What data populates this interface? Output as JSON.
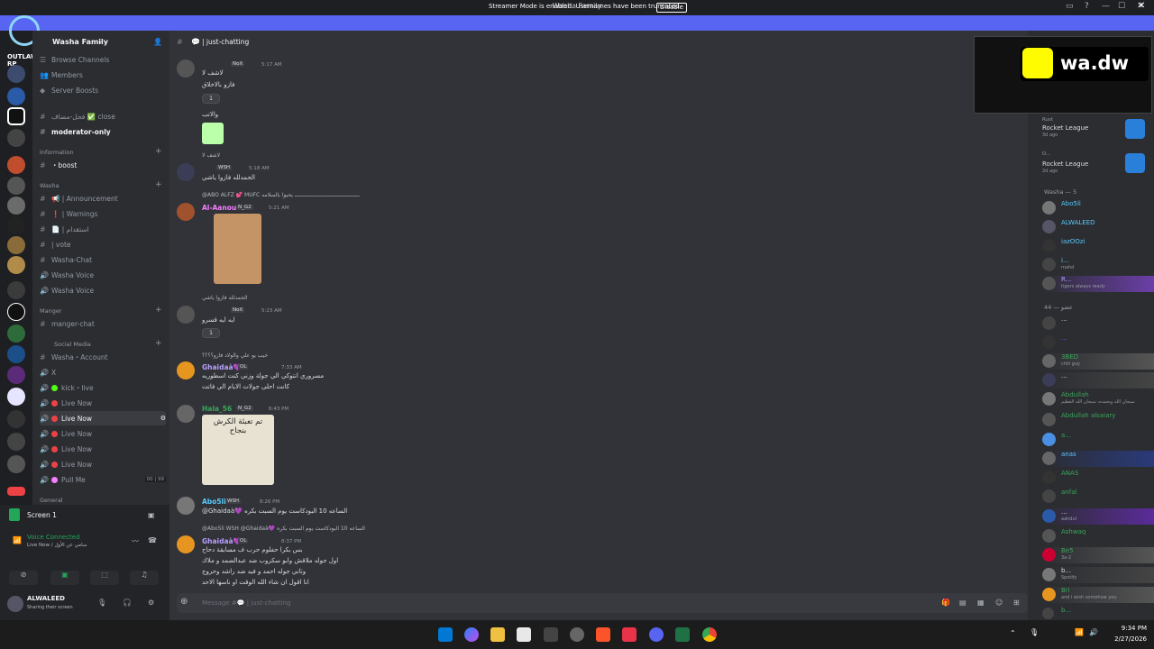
{
  "window": {
    "title": "Washa Family",
    "controls": [
      "—",
      "☐",
      "✕"
    ]
  },
  "banner": {
    "text": "Streamer Mode is enabled. Usernames have been truncated.",
    "button": "Disable",
    "color": "#5865f2"
  },
  "guild_logo": {
    "text": "OUTLAW RP"
  },
  "server": {
    "name": "Washa Family"
  },
  "sidebar": {
    "top_items": [
      {
        "label": "Browse Channels",
        "icon": "browse-icon"
      },
      {
        "label": "Members",
        "icon": "members-icon"
      },
      {
        "label": "Server Boosts",
        "icon": "boost-icon"
      }
    ],
    "channels": [
      {
        "label": "فحل-مضاف ✅ close",
        "type": "text"
      },
      {
        "label": "moderator-only",
        "type": "text",
        "active": true
      },
      {
        "label": "Information",
        "type": "category"
      },
      {
        "label": "・boost",
        "type": "text",
        "active": true
      },
      {
        "label": "Washa",
        "type": "category"
      },
      {
        "label": "📢 | Announcement",
        "type": "text"
      },
      {
        "label": "❗ | Warnings",
        "type": "text"
      },
      {
        "label": "📄 | استقدام",
        "type": "text"
      },
      {
        "label": "| vote",
        "type": "text"
      },
      {
        "label": "Washa-Chat",
        "type": "text"
      },
      {
        "label": "Washa Voice",
        "type": "voice"
      },
      {
        "label": "Washa Voice",
        "type": "voice"
      },
      {
        "label": "Manger",
        "type": "category"
      },
      {
        "label": "manger-chat",
        "type": "text"
      },
      {
        "label": "Social Media",
        "type": "category"
      },
      {
        "label": "Washa・Account",
        "type": "text"
      },
      {
        "label": "X",
        "type": "voice"
      },
      {
        "label": "kick・live",
        "type": "voice"
      },
      {
        "label": "Live Now",
        "type": "voice"
      },
      {
        "label": "Live Now",
        "type": "voice",
        "active": true
      },
      {
        "label": "Live Now",
        "type": "voice"
      },
      {
        "label": "Live Now",
        "type": "voice"
      },
      {
        "label": "Live Now",
        "type": "voice"
      },
      {
        "label": "Pull Me",
        "type": "voice",
        "counts": "00 | 99"
      },
      {
        "label": "General",
        "type": "category"
      }
    ]
  },
  "stream_panel": {
    "label": "Screen 1"
  },
  "voice": {
    "status": "Voice Connected",
    "channel": "Live Now / سامي عن الأول"
  },
  "user": {
    "name": "ALWALEED",
    "status": "Sharing their screen"
  },
  "channel_header": {
    "name": "| just-chatting"
  },
  "messages": [
    {
      "name": "",
      "tag": "NoX",
      "time": "5:17 AM",
      "lines": [
        "لاشف لا",
        "فازو بالاخلاق"
      ],
      "reaction": "1",
      "extra": "والاتب"
    },
    {
      "name": "",
      "reply": "لاشف لا",
      "tag": "WSH",
      "time": "5:18 AM",
      "lines": [
        "الحمدلله فازوا ياشي"
      ]
    },
    {
      "name": "Al-Aanoud",
      "reply": "@ABO ALFZ 💕 MUFC ـــــــــــــــــــــــــــــــــــــــــ يحيوا بالسلامه",
      "tag": "N_G2",
      "time": "5:21 AM"
    },
    {
      "name": "",
      "reply": "الحمدلله فازوا ياشي",
      "tag": "NoX",
      "time": "5:23 AM",
      "lines": [
        "ايه ايه قسرو"
      ],
      "reaction": "1"
    },
    {
      "name": "Ghaidaà💜",
      "reply": "خيب يو علي والولاد فازو؟؟؟؟",
      "tag": "OL",
      "time": "7:33 AM",
      "lines": [
        "مسروري انتوكي الي جولة وزني كنت اسطوريه",
        "كانت احلى جولات الايام الي فاتت"
      ]
    },
    {
      "name": "Hala_56",
      "tag": "N_G2",
      "time": "6:43 PM",
      "sticker": "تم تعبئة الكرش بنجاح"
    },
    {
      "name": "Abo5li",
      "tag": "WSH",
      "time": "8:26 PM",
      "lines": [
        "@Ghaidaà💜 الساعه 10 البودكاست يوم السبت بكره"
      ]
    },
    {
      "name": "Ghaidaà💜",
      "reply": "@Abo5li WSH @Ghaidaà💜 الساعه 10 البودكاست يوم السبت بكره",
      "tag": "OL",
      "time": "8:37 PM",
      "lines": [
        "بس بكرا حفلوم حرب ف مسابقة دحاح",
        "اول جوله ملاقش وابو سكروب ضد عبدالصمد و ملاك",
        "وثاني جوله احمد و فيد ضد راشد وحروج",
        "انا اقول ان شاء الله الوقت او ناسها الاحد"
      ]
    }
  ],
  "composer": {
    "placeholder": "Message #💬 | just-chatting"
  },
  "stream_preview": {
    "brand": "wa.dw"
  },
  "members": {
    "activity": [
      {
        "name": "Rocket League",
        "sub": "Rust",
        "time": "3d ago"
      },
      {
        "name": "Rocket League",
        "sub": "O...",
        "time": "2d ago"
      }
    ],
    "category1": "Washa — 5",
    "group1": [
      {
        "name": "Abo5li",
        "tag": "WSH",
        "color": "#5ac8fa"
      },
      {
        "name": "ALWALEED",
        "tag": "WSH",
        "color": "#5ac8fa"
      },
      {
        "name": "iazOOzi",
        "tag": "OL",
        "color": "#5ac8fa"
      },
      {
        "name": "i...",
        "tag": "WSH",
        "color": "#5ac8fa",
        "sub": "mahd"
      },
      {
        "name": "R...",
        "tag": "Dle",
        "color": "#b9a0ff",
        "sub": "tigers always ready"
      }
    ],
    "category2": "عضو — 44",
    "group2": [
      {
        "name": "...",
        "tag": "OL",
        "color": "#dbdee1"
      },
      {
        "name": "...",
        "tag": "OL",
        "color": "#5865f2"
      },
      {
        "name": "3BED",
        "tag": "Sky",
        "color": "#3ba55c",
        "sub": "chill guy"
      },
      {
        "name": "...",
        "tag": "Mani",
        "color": "#dbdee1"
      },
      {
        "name": "Abdullah",
        "tag": "GOAT",
        "color": "#3ba55c",
        "sub": "سبحان الله وبحمده، سبحان الله العظيم"
      },
      {
        "name": "Abdullah alsaiary",
        "tag": "MT",
        "color": "#3ba55c"
      },
      {
        "name": "a...",
        "tag": "",
        "color": "#3ba55c"
      },
      {
        "name": "anas",
        "tag": "057",
        "color": "#5ac8fa"
      },
      {
        "name": "ANAS",
        "tag": "",
        "color": "#3ba55c"
      },
      {
        "name": "anfal",
        "tag": "",
        "color": "#3ba55c"
      },
      {
        "name": "...",
        "tag": "7RB",
        "color": "#dbdee1",
        "sub": "aahdul"
      },
      {
        "name": "Ashwaq",
        "tag": "LVU",
        "color": "#3ba55c"
      },
      {
        "name": "Be5",
        "tag": "",
        "color": "#3ba55c",
        "sub": "3a-2"
      },
      {
        "name": "b...",
        "tag": "",
        "color": "#dbdee1",
        "sub": "Spotify"
      },
      {
        "name": "Bri",
        "tag": "511",
        "color": "#3ba55c",
        "sub": "and i wish somehow you"
      },
      {
        "name": "b...",
        "tag": "",
        "color": "#3ba55c"
      }
    ]
  },
  "taskbar": {
    "time": "9:34 PM",
    "date": "2/27/2026"
  }
}
